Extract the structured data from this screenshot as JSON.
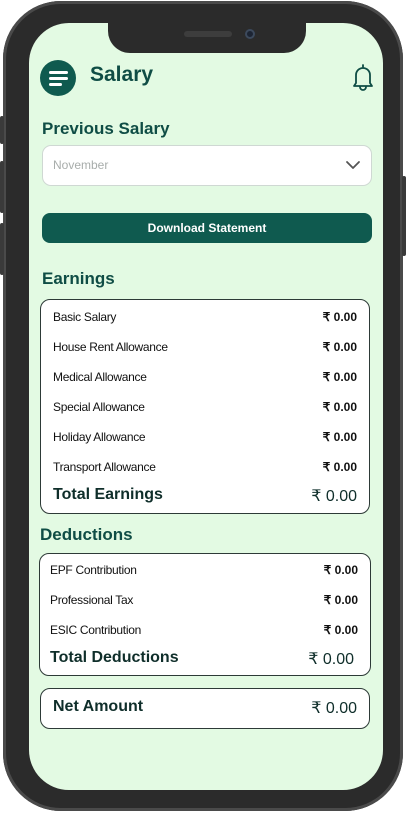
{
  "header": {
    "title": "Salary",
    "menu_icon": "hamburger-menu-icon",
    "notification_icon": "bell-icon"
  },
  "previous_salary": {
    "label": "Previous Salary",
    "selected_month": "November"
  },
  "download_button": "Download Statement",
  "earnings": {
    "label": "Earnings",
    "items": [
      {
        "label": "Basic Salary",
        "amount": "₹ 0.00"
      },
      {
        "label": "House Rent Allowance",
        "amount": "₹ 0.00"
      },
      {
        "label": "Medical Allowance",
        "amount": "₹ 0.00"
      },
      {
        "label": "Special Allowance",
        "amount": "₹ 0.00"
      },
      {
        "label": "Holiday Allowance",
        "amount": "₹ 0.00"
      },
      {
        "label": "Transport Allowance",
        "amount": "₹ 0.00"
      }
    ],
    "total_label": "Total Earnings",
    "total_amount": "₹ 0.00"
  },
  "deductions": {
    "label": "Deductions",
    "items": [
      {
        "label": "EPF Contribution",
        "amount": "₹ 0.00"
      },
      {
        "label": "Professional Tax",
        "amount": "₹ 0.00"
      },
      {
        "label": "ESIC Contribution",
        "amount": "₹ 0.00"
      }
    ],
    "total_label": "Total Deductions",
    "total_amount": "₹ 0.00"
  },
  "net": {
    "label": "Net Amount",
    "amount": "₹ 0.00"
  },
  "colors": {
    "primary": "#0f5a4f",
    "background": "#e3fae3"
  }
}
